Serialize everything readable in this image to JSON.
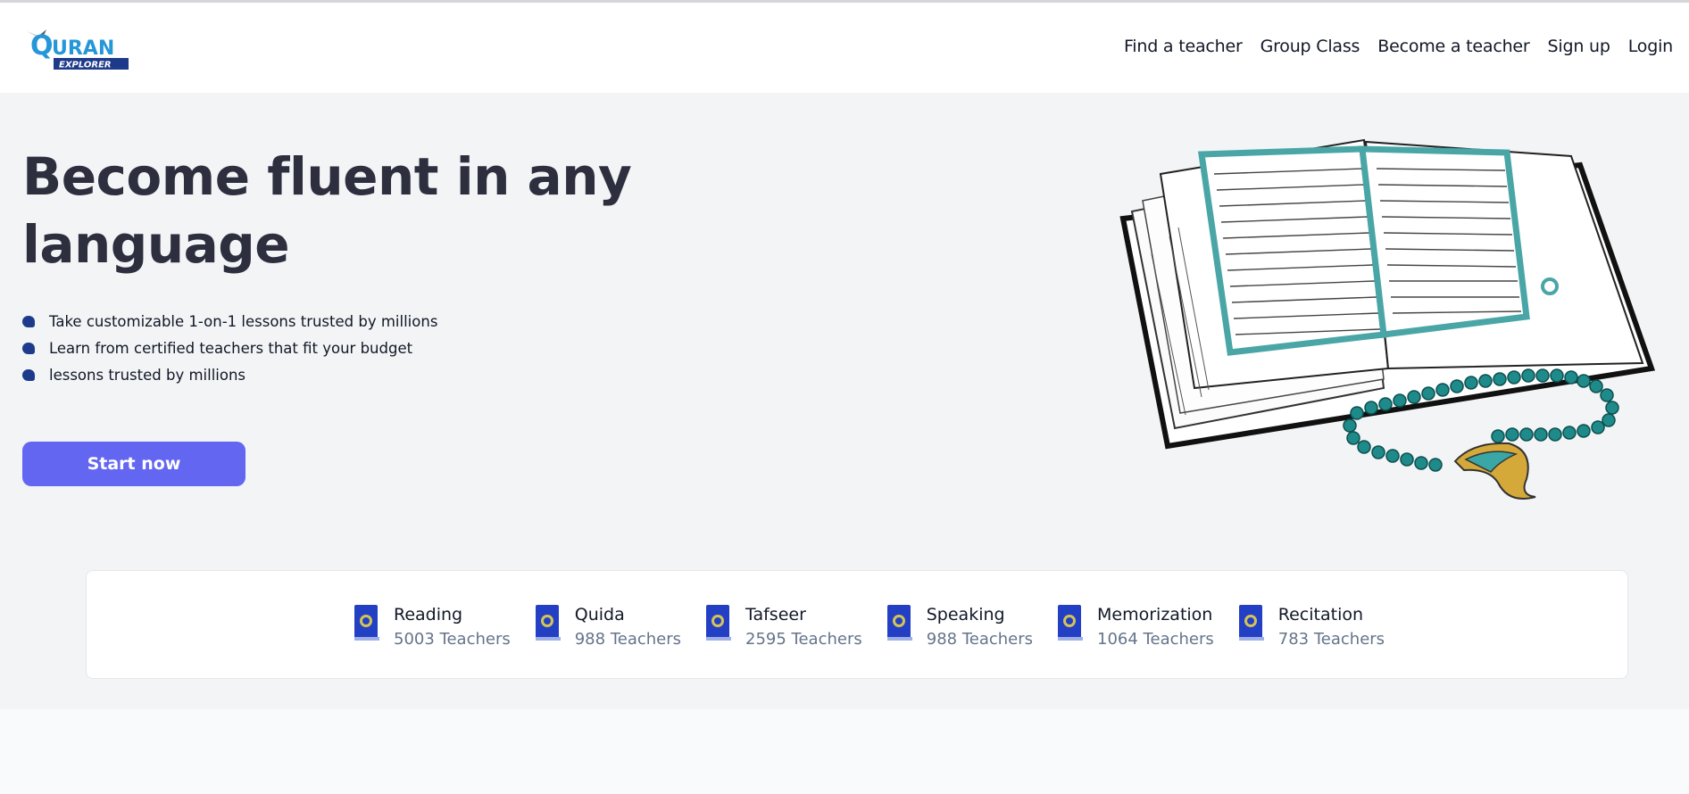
{
  "brand": {
    "logo_main": "URAN",
    "logo_q": "Q",
    "logo_sub": "EXPLORER",
    "colors": {
      "primary": "#2596d8",
      "navy": "#1e3a8a"
    }
  },
  "nav": {
    "items": [
      {
        "label": "Find a teacher"
      },
      {
        "label": "Group Class"
      },
      {
        "label": "Become a teacher"
      },
      {
        "label": "Sign up"
      },
      {
        "label": "Login"
      }
    ]
  },
  "hero": {
    "title": "Become fluent in any language",
    "features": [
      {
        "text": "Take customizable 1-on-1 lessons trusted by millions"
      },
      {
        "text": "Learn from certified teachers that fit your budget"
      },
      {
        "text": "lessons trusted by millions"
      }
    ],
    "cta_label": "Start now",
    "cta_color": "#6366f1",
    "image_icon": "open-quran-with-prayer-beads-illustration"
  },
  "categories": [
    {
      "name": "Reading",
      "count": "5003 Teachers"
    },
    {
      "name": "Quida",
      "count": "988 Teachers"
    },
    {
      "name": "Tafseer",
      "count": "2595 Teachers"
    },
    {
      "name": "Speaking",
      "count": "988 Teachers"
    },
    {
      "name": "Memorization",
      "count": "1064 Teachers"
    },
    {
      "name": "Recitation",
      "count": "783 Teachers"
    }
  ]
}
